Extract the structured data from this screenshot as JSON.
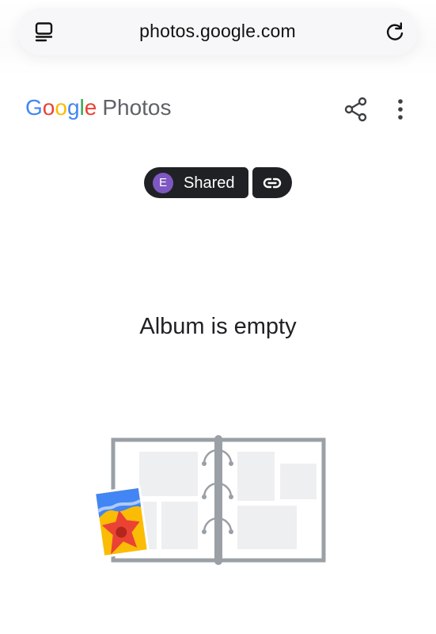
{
  "browser": {
    "url": "photos.google.com",
    "icons": {
      "tabs": "tabs-icon",
      "reload": "reload-icon"
    }
  },
  "header": {
    "logo_google": [
      "G",
      "o",
      "o",
      "g",
      "l",
      "e"
    ],
    "logo_product": "Photos",
    "icons": {
      "share": "share-icon",
      "more": "more-vert-icon"
    }
  },
  "shared_chip": {
    "avatar_initial": "E",
    "label": "Shared",
    "link_icon": "link-icon"
  },
  "empty_state": {
    "title": "Album is empty",
    "illustration": "photo-album-illustration"
  },
  "colors": {
    "google_blue": "#4285F4",
    "google_red": "#EA4335",
    "google_yellow": "#FBBC05",
    "google_green": "#34A853",
    "chip_bg": "#202124",
    "avatar_bg": "#7E57C2"
  }
}
